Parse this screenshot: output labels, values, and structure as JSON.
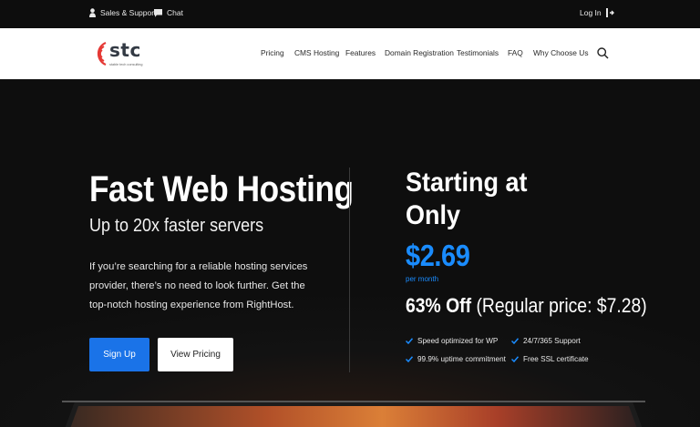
{
  "topbar": {
    "sales_label": "Sales & Support",
    "chat_label": "Chat",
    "login_label": "Log In"
  },
  "logo": {
    "name": "stc",
    "tagline": "stable tech consulting"
  },
  "nav": {
    "items": [
      "Pricing",
      "CMS Hosting",
      "Features",
      "Domain Registration",
      "Testimonials",
      "FAQ",
      "Why Choose Us"
    ]
  },
  "hero": {
    "title": "Fast Web Hosting",
    "subtitle": "Up to 20x faster servers",
    "description": "If you’re searching for a reliable hosting services provider, there’s no need to look further. Get the top-notch hosting experience from RightHost.",
    "signup_label": "Sign Up",
    "pricing_label": "View Pricing"
  },
  "offer": {
    "title": "Starting at Only",
    "price": "$2.69",
    "period": "per month",
    "discount": "63% Off",
    "regular": "(Regular price: $7.28)",
    "features": [
      "Speed optimized for WP",
      "24/7/365 Support",
      "99.9% uptime commitment",
      "Free SSL certificate"
    ]
  },
  "colors": {
    "accent": "#1a73e8",
    "price": "#1a8cff",
    "logo_red": "#e53935"
  }
}
